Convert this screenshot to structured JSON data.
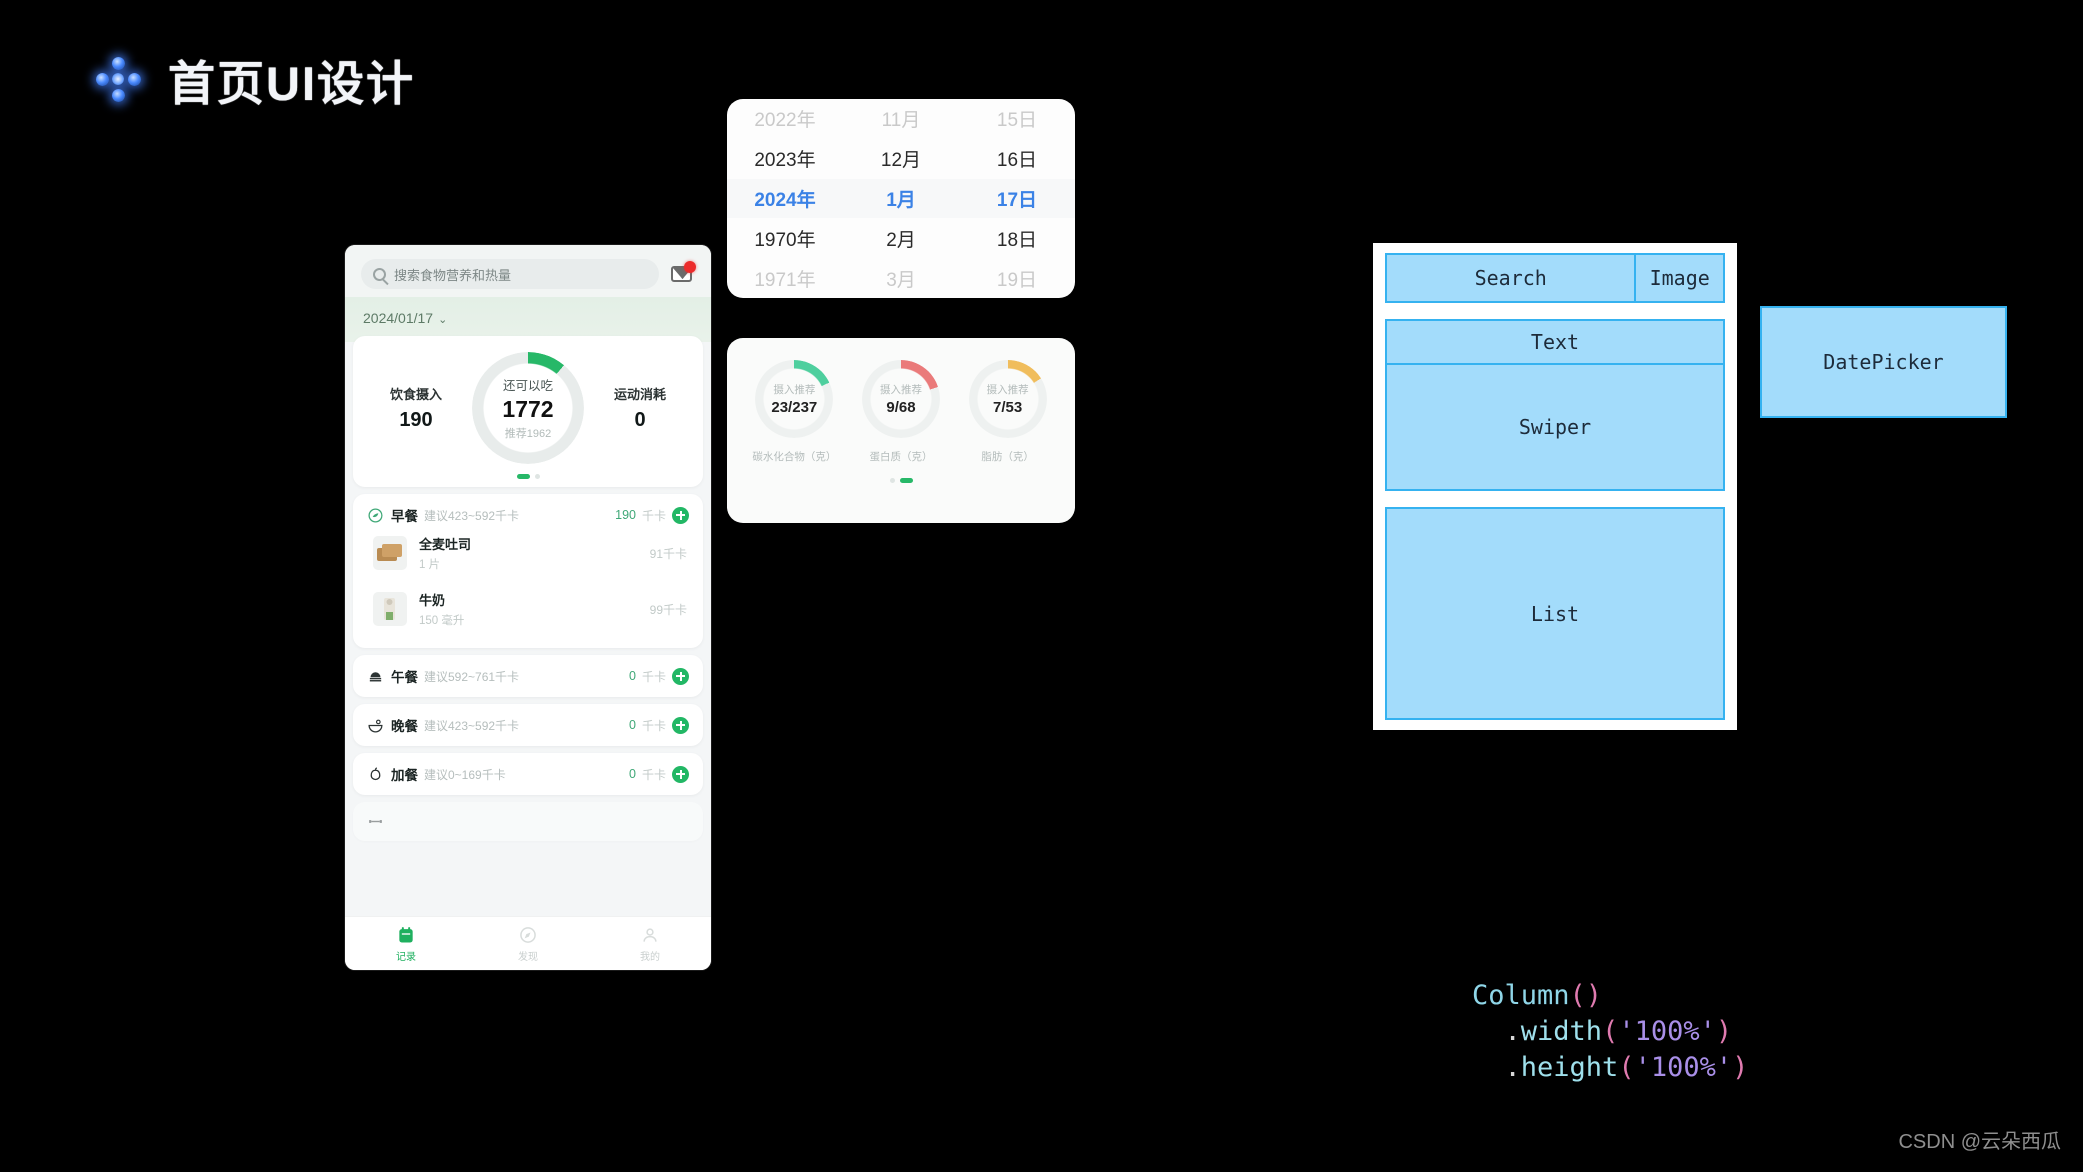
{
  "page": {
    "title": "首页UI设计",
    "background_color": "#000000",
    "sparkle_icon": "sparkle-icon"
  },
  "phone": {
    "search": {
      "icon": "search-icon",
      "placeholder": "搜索食物营养和热量",
      "mail_icon": "mail-icon",
      "badge": ""
    },
    "date_bar": {
      "value": "2024/01/17",
      "caret": "⌄"
    },
    "summary": {
      "intake_label": "饮食摄入",
      "intake_value": "190",
      "ring_label": "还可以吃",
      "ring_value": "1772",
      "ring_sub": "推荐1962",
      "burn_label": "运动消耗",
      "burn_value": "0",
      "ring_percent": 11,
      "ring_color": "#27b868"
    },
    "meals": [
      {
        "icon": "breakfast-icon",
        "name": "早餐",
        "suggestion": "建议423~592千卡",
        "kcal": "190",
        "unit": "千卡",
        "foods": [
          {
            "name": "全麦吐司",
            "qty": "1 片",
            "kcal": "91千卡",
            "thumb": "toast-thumb"
          },
          {
            "name": "牛奶",
            "qty": "150 毫升",
            "kcal": "99千卡",
            "thumb": "milk-thumb"
          }
        ]
      },
      {
        "icon": "lunch-icon",
        "name": "午餐",
        "suggestion": "建议592~761千卡",
        "kcal": "0",
        "unit": "千卡",
        "foods": []
      },
      {
        "icon": "dinner-icon",
        "name": "晚餐",
        "suggestion": "建议423~592千卡",
        "kcal": "0",
        "unit": "千卡",
        "foods": []
      },
      {
        "icon": "snack-icon",
        "name": "加餐",
        "suggestion": "建议0~169千卡",
        "kcal": "0",
        "unit": "千卡",
        "foods": []
      }
    ],
    "tabbar": [
      {
        "label": "记录",
        "icon": "calendar-icon",
        "active": true
      },
      {
        "label": "发现",
        "icon": "discover-icon",
        "active": false
      },
      {
        "label": "我的",
        "icon": "profile-icon",
        "active": false
      }
    ]
  },
  "date_picker_card": {
    "rows": [
      {
        "year": "2022年",
        "month": "11月",
        "day": "15日",
        "state": "faded"
      },
      {
        "year": "2023年",
        "month": "12月",
        "day": "16日",
        "state": "normal"
      },
      {
        "year": "2024年",
        "month": "1月",
        "day": "17日",
        "state": "selected"
      },
      {
        "year": "1970年",
        "month": "2月",
        "day": "18日",
        "state": "normal"
      },
      {
        "year": "1971年",
        "month": "3月",
        "day": "19日",
        "state": "faded"
      }
    ],
    "selected_color": "#3b82e6"
  },
  "nutrition_card": {
    "items": [
      {
        "ring_label": "摄入推荐",
        "value": "23/237",
        "name": "碳水化合物（克）",
        "color": "#4ecf9e",
        "percent": 18
      },
      {
        "ring_label": "摄入推荐",
        "value": "9/68",
        "name": "蛋白质（克）",
        "color": "#ea7a7a",
        "percent": 20
      },
      {
        "ring_label": "摄入推荐",
        "value": "7/53",
        "name": "脂肪（克）",
        "color": "#f0bd5c",
        "percent": 16
      }
    ]
  },
  "wireframe": {
    "search": "Search",
    "image": "Image",
    "text": "Text",
    "swiper": "Swiper",
    "list": "List",
    "datepicker": "DatePicker",
    "fill_color": "#a3dcfb",
    "border_color": "#35b2f0"
  },
  "code": {
    "line1_ident": "Column",
    "line1_paren": "()",
    "line2_dot": ".",
    "line2_method": "width",
    "line2_open": "(",
    "line2_string": "'100%'",
    "line2_close": ")",
    "line3_dot": ".",
    "line3_method": "height",
    "line3_open": "(",
    "line3_string": "'100%'",
    "line3_close": ")"
  },
  "watermark": "CSDN @云朵西瓜"
}
